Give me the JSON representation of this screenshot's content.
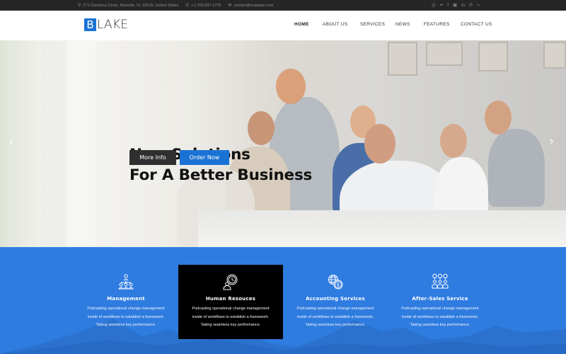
{
  "topbar": {
    "address": "271 Dominica Circle, Niceville, FL 32578, United States",
    "phone": "+1 703-697-1776",
    "email": "contact@example.com",
    "social": [
      {
        "name": "dribbble",
        "glyph": "◎"
      },
      {
        "name": "flickr",
        "glyph": "••"
      },
      {
        "name": "facebook",
        "glyph": "f"
      },
      {
        "name": "instagram",
        "glyph": "▣"
      },
      {
        "name": "linkedin",
        "glyph": "in"
      },
      {
        "name": "pinterest",
        "glyph": "℗"
      },
      {
        "name": "rss",
        "glyph": "⌁"
      }
    ]
  },
  "header": {
    "logo_letter": "B",
    "logo_rest": "LAKE",
    "nav": [
      "HOME",
      "ABOUT US",
      "SERVICES",
      "NEWS",
      "FEATURES",
      "CONTACT US"
    ]
  },
  "hero": {
    "title_line1": "New Solutions",
    "title_line2": "For A Better Business",
    "btn_more": "More Info",
    "btn_order": "Order Now",
    "prev_arrow": "‹",
    "next_arrow": "›"
  },
  "services": [
    {
      "title": "Management",
      "icon": "team-hierarchy",
      "lines": [
        "Podcasting operational change management",
        "inside of workflows to establish a framework.",
        "Taking seamless key performance."
      ]
    },
    {
      "title": "Human Resouces",
      "icon": "user-clock",
      "lines": [
        "Podcasting operational change management",
        "inside of workflows to establish a framework.",
        "Taking seamless key performance."
      ]
    },
    {
      "title": "Accounting Services",
      "icon": "globe-dollar",
      "lines": [
        "Podcasting operational change management",
        "inside of workflows to establish a framework.",
        "Taking seamless key performance."
      ]
    },
    {
      "title": "After-Sales Service",
      "icon": "support-team",
      "lines": [
        "Podcasting operational change management",
        "inside of workflows to establish a framework.",
        "Taking seamless key performance."
      ]
    }
  ],
  "colors": {
    "accent": "#1a73d4",
    "services_bg": "#2f7ce0",
    "topbar_bg": "#262626",
    "active_card": "#000000"
  }
}
